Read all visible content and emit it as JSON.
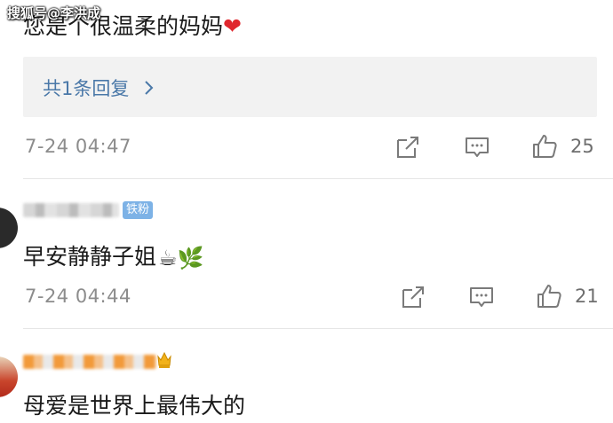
{
  "watermark": "搜狐号@李洪成",
  "comments": [
    {
      "text": "您是个很温柔的妈妈",
      "emoji": "❤",
      "replies_link": "共1条回复",
      "time": "7-24 04:47",
      "likes": "25"
    },
    {
      "badge": "铁粉",
      "text": "早安静静子姐",
      "emoji": "☕🌿",
      "time": "7-24 04:44",
      "likes": "21"
    },
    {
      "text": "母爱是世界上最伟大的"
    }
  ],
  "icons": {
    "share": "share-icon",
    "comment": "comment-icon",
    "like": "thumbs-up-icon",
    "chevron": "chevron-right-icon"
  },
  "colors": {
    "link": "#4a78a8",
    "meta": "#8c8c8c",
    "badge": "#7db2e6",
    "heart": "#e0272e",
    "reply_bg": "#f2f2f2"
  }
}
